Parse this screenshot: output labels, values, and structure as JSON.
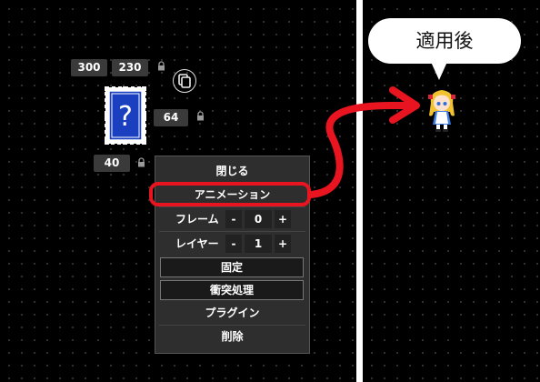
{
  "editor": {
    "width_value": "300",
    "height_value": "230",
    "side_value": "64",
    "bottom_value": "40"
  },
  "sprite": {
    "glyph": "?"
  },
  "context_menu": {
    "close_label": "閉じる",
    "animation_label": "アニメーション",
    "frame": {
      "label": "フレーム",
      "minus": "-",
      "value": "0",
      "plus": "+"
    },
    "layer": {
      "label": "レイヤー",
      "minus": "-",
      "value": "1",
      "plus": "+"
    },
    "fixed_label": "固定",
    "collision_label": "衝突処理",
    "plugin_label": "プラグイン",
    "delete_label": "削除"
  },
  "preview": {
    "bubble_text": "適用後"
  },
  "colors": {
    "highlight": "#e8141f",
    "sprite_blue": "#1a3fbf",
    "panel_bg": "#000000"
  },
  "icons": [
    "lock-icon",
    "copy-icon",
    "curved-arrow-icon"
  ]
}
